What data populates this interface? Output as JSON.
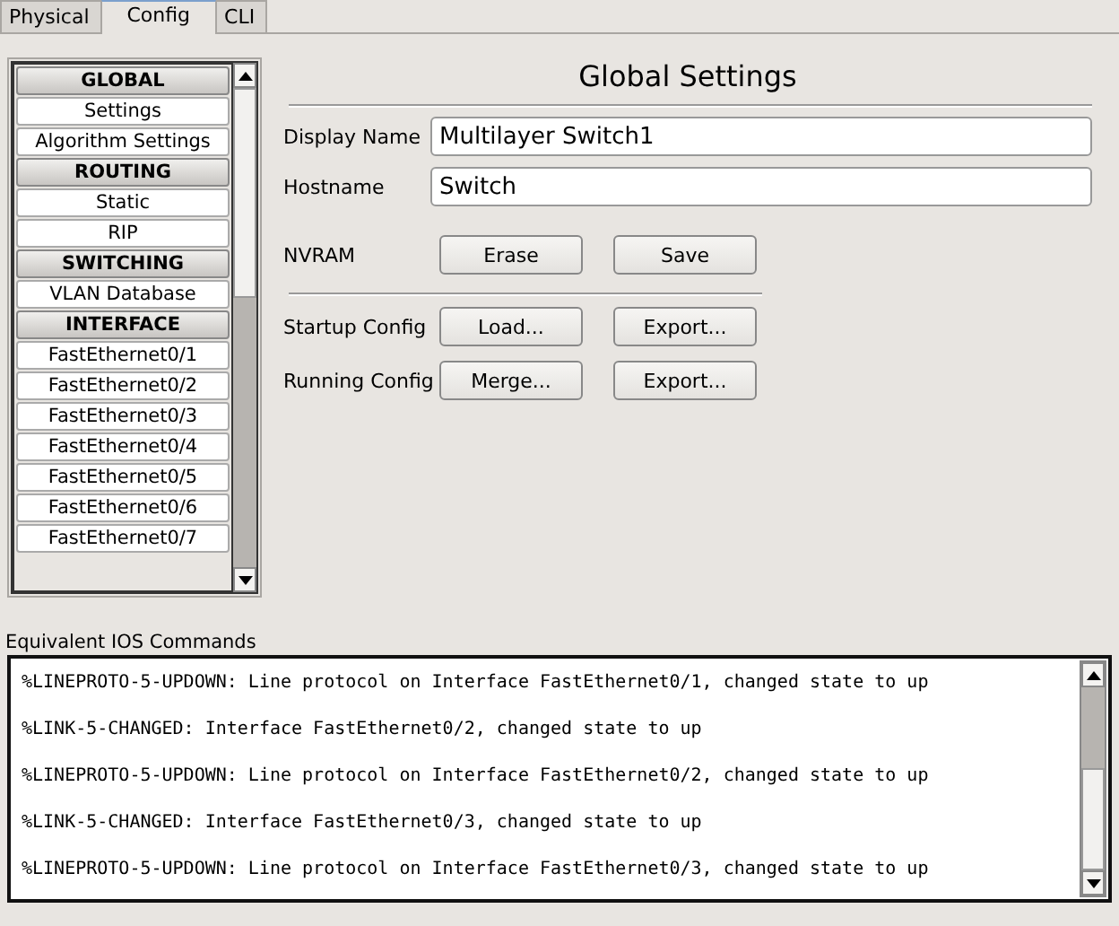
{
  "tabs": [
    {
      "label": "Physical",
      "selected": false
    },
    {
      "label": "Config",
      "selected": true
    },
    {
      "label": "CLI",
      "selected": false
    }
  ],
  "sidebar": {
    "items": [
      {
        "kind": "header",
        "label": "GLOBAL"
      },
      {
        "kind": "item",
        "label": "Settings"
      },
      {
        "kind": "item",
        "label": "Algorithm Settings"
      },
      {
        "kind": "header",
        "label": "ROUTING"
      },
      {
        "kind": "item",
        "label": "Static"
      },
      {
        "kind": "item",
        "label": "RIP"
      },
      {
        "kind": "header",
        "label": "SWITCHING"
      },
      {
        "kind": "item",
        "label": "VLAN Database"
      },
      {
        "kind": "header",
        "label": "INTERFACE"
      },
      {
        "kind": "item",
        "label": "FastEthernet0/1"
      },
      {
        "kind": "item",
        "label": "FastEthernet0/2"
      },
      {
        "kind": "item",
        "label": "FastEthernet0/3"
      },
      {
        "kind": "item",
        "label": "FastEthernet0/4"
      },
      {
        "kind": "item",
        "label": "FastEthernet0/5"
      },
      {
        "kind": "item",
        "label": "FastEthernet0/6"
      },
      {
        "kind": "item",
        "label": "FastEthernet0/7"
      }
    ]
  },
  "settings": {
    "title": "Global Settings",
    "fields": [
      {
        "label": "Display Name",
        "value": "Multilayer Switch1"
      },
      {
        "label": "Hostname",
        "value": "Switch"
      }
    ],
    "nvram": {
      "label": "NVRAM",
      "buttons": [
        "Erase",
        "Save"
      ]
    },
    "config_rows": [
      {
        "label": "Startup Config",
        "buttons": [
          "Load...",
          "Export..."
        ]
      },
      {
        "label": "Running Config",
        "buttons": [
          "Merge...",
          "Export..."
        ]
      }
    ]
  },
  "console": {
    "label": "Equivalent IOS Commands",
    "lines": [
      "%LINEPROTO-5-UPDOWN: Line protocol on Interface FastEthernet0/1, changed state to up",
      "%LINK-5-CHANGED: Interface FastEthernet0/2, changed state to up",
      "%LINEPROTO-5-UPDOWN: Line protocol on Interface FastEthernet0/2, changed state to up",
      "%LINK-5-CHANGED: Interface FastEthernet0/3, changed state to up",
      "%LINEPROTO-5-UPDOWN: Line protocol on Interface FastEthernet0/3, changed state to up"
    ]
  }
}
